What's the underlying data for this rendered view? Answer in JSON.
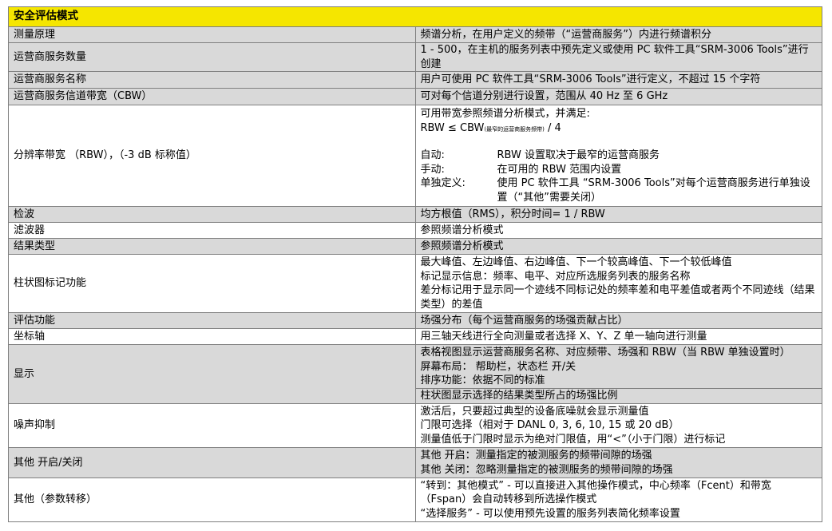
{
  "title": "安全评估模式",
  "rows": {
    "r1": {
      "label": "测量原理",
      "value": "频谱分析，在用户定义的频带（“运营商服务”）内进行频谱积分"
    },
    "r2": {
      "label": "运营商服务数量",
      "value": "1 - 500，在主机的服务列表中预先定义或使用 PC 软件工具“SRM-3006 Tools”进行创建"
    },
    "r3": {
      "label": "运营商服务名称",
      "value": "用户可使用 PC 软件工具“SRM-3006 Tools”进行定义，不超过 15 个字符"
    },
    "r4": {
      "label": "运营商服务信道带宽（CBW）",
      "value": "可对每个信道分别进行设置，范围从 40 Hz 至 6 GHz"
    },
    "r5": {
      "label": "分辨率带宽 （RBW），（-3 dB 标称值）",
      "intro": "可用带宽参照频谱分析模式，并满足:",
      "formula_a": "RBW ≤ CBW",
      "formula_sub": "(最窄的运营商服务频带)",
      "formula_b": " / 4",
      "auto_k": "自动:",
      "auto_v": "RBW 设置取决于最窄的运营商服务",
      "manual_k": "手动:",
      "manual_v": "在可用的 RBW 范围内设置",
      "single_k": "单独定义:",
      "single_v": "使用 PC 软件工具 “SRM-3006 Tools”对每个运营商服务进行单独设置（“其他”需要关闭）"
    },
    "r6": {
      "label": "检波",
      "value": "均方根值（RMS），积分时间= 1 / RBW"
    },
    "r7": {
      "label": "滤波器",
      "value": "参照频谱分析模式"
    },
    "r8": {
      "label": "结果类型",
      "value": "参照频谱分析模式"
    },
    "r9": {
      "label": "柱状图标记功能",
      "l1": "最大峰值、左边峰值、右边峰值、下一个较高峰值、下一个较低峰值",
      "l2": "标记显示信息：频率、电平、对应所选服务列表的服务名称",
      "l3": "差分标记用于显示同一个迹线不同标记处的频率差和电平差值或者两个不同迹线（结果类型）的差值"
    },
    "r10": {
      "label": "评估功能",
      "value": "场强分布（每个运营商服务的场强贡献占比）"
    },
    "r11": {
      "label": "坐标轴",
      "value": "用三轴天线进行全向测量或者选择 X、Y、Z 单一轴向进行测量"
    },
    "r12": {
      "label": "显示",
      "l1": "表格视图显示运营商服务名称、对应频带、场强和 RBW（当 RBW 单独设置时）",
      "l2": "屏幕布局： 帮助栏，状态栏 开/关",
      "l3": "排序功能：依据不同的标准",
      "l4": "柱状图显示选择的结果类型所占的场强比例"
    },
    "r13": {
      "label": "噪声抑制",
      "l1": "激活后，只要超过典型的设备底噪就会显示测量值",
      "l2": "门限可选择（相对于 DANL 0, 3, 6, 10, 15 或 20 dB）",
      "l3": "测量值低于门限时显示为绝对门限值，用“<”（小于门限）进行标记"
    },
    "r14": {
      "label": "其他 开启/关闭",
      "l1": "其他 开启：测量指定的被测服务的频带间隙的场强",
      "l2": "其他 关闭：忽略测量指定的被测服务的频带间隙的场强"
    },
    "r15": {
      "label": "其他（参数转移）",
      "l1": "“转到：其他模式” - 可以直接进入其他操作模式，中心频率（Fcent）和带宽（Fspan）会自动转移到所选操作模式",
      "l2": "“选择服务” - 可以使用预先设置的服务列表简化频率设置"
    }
  }
}
